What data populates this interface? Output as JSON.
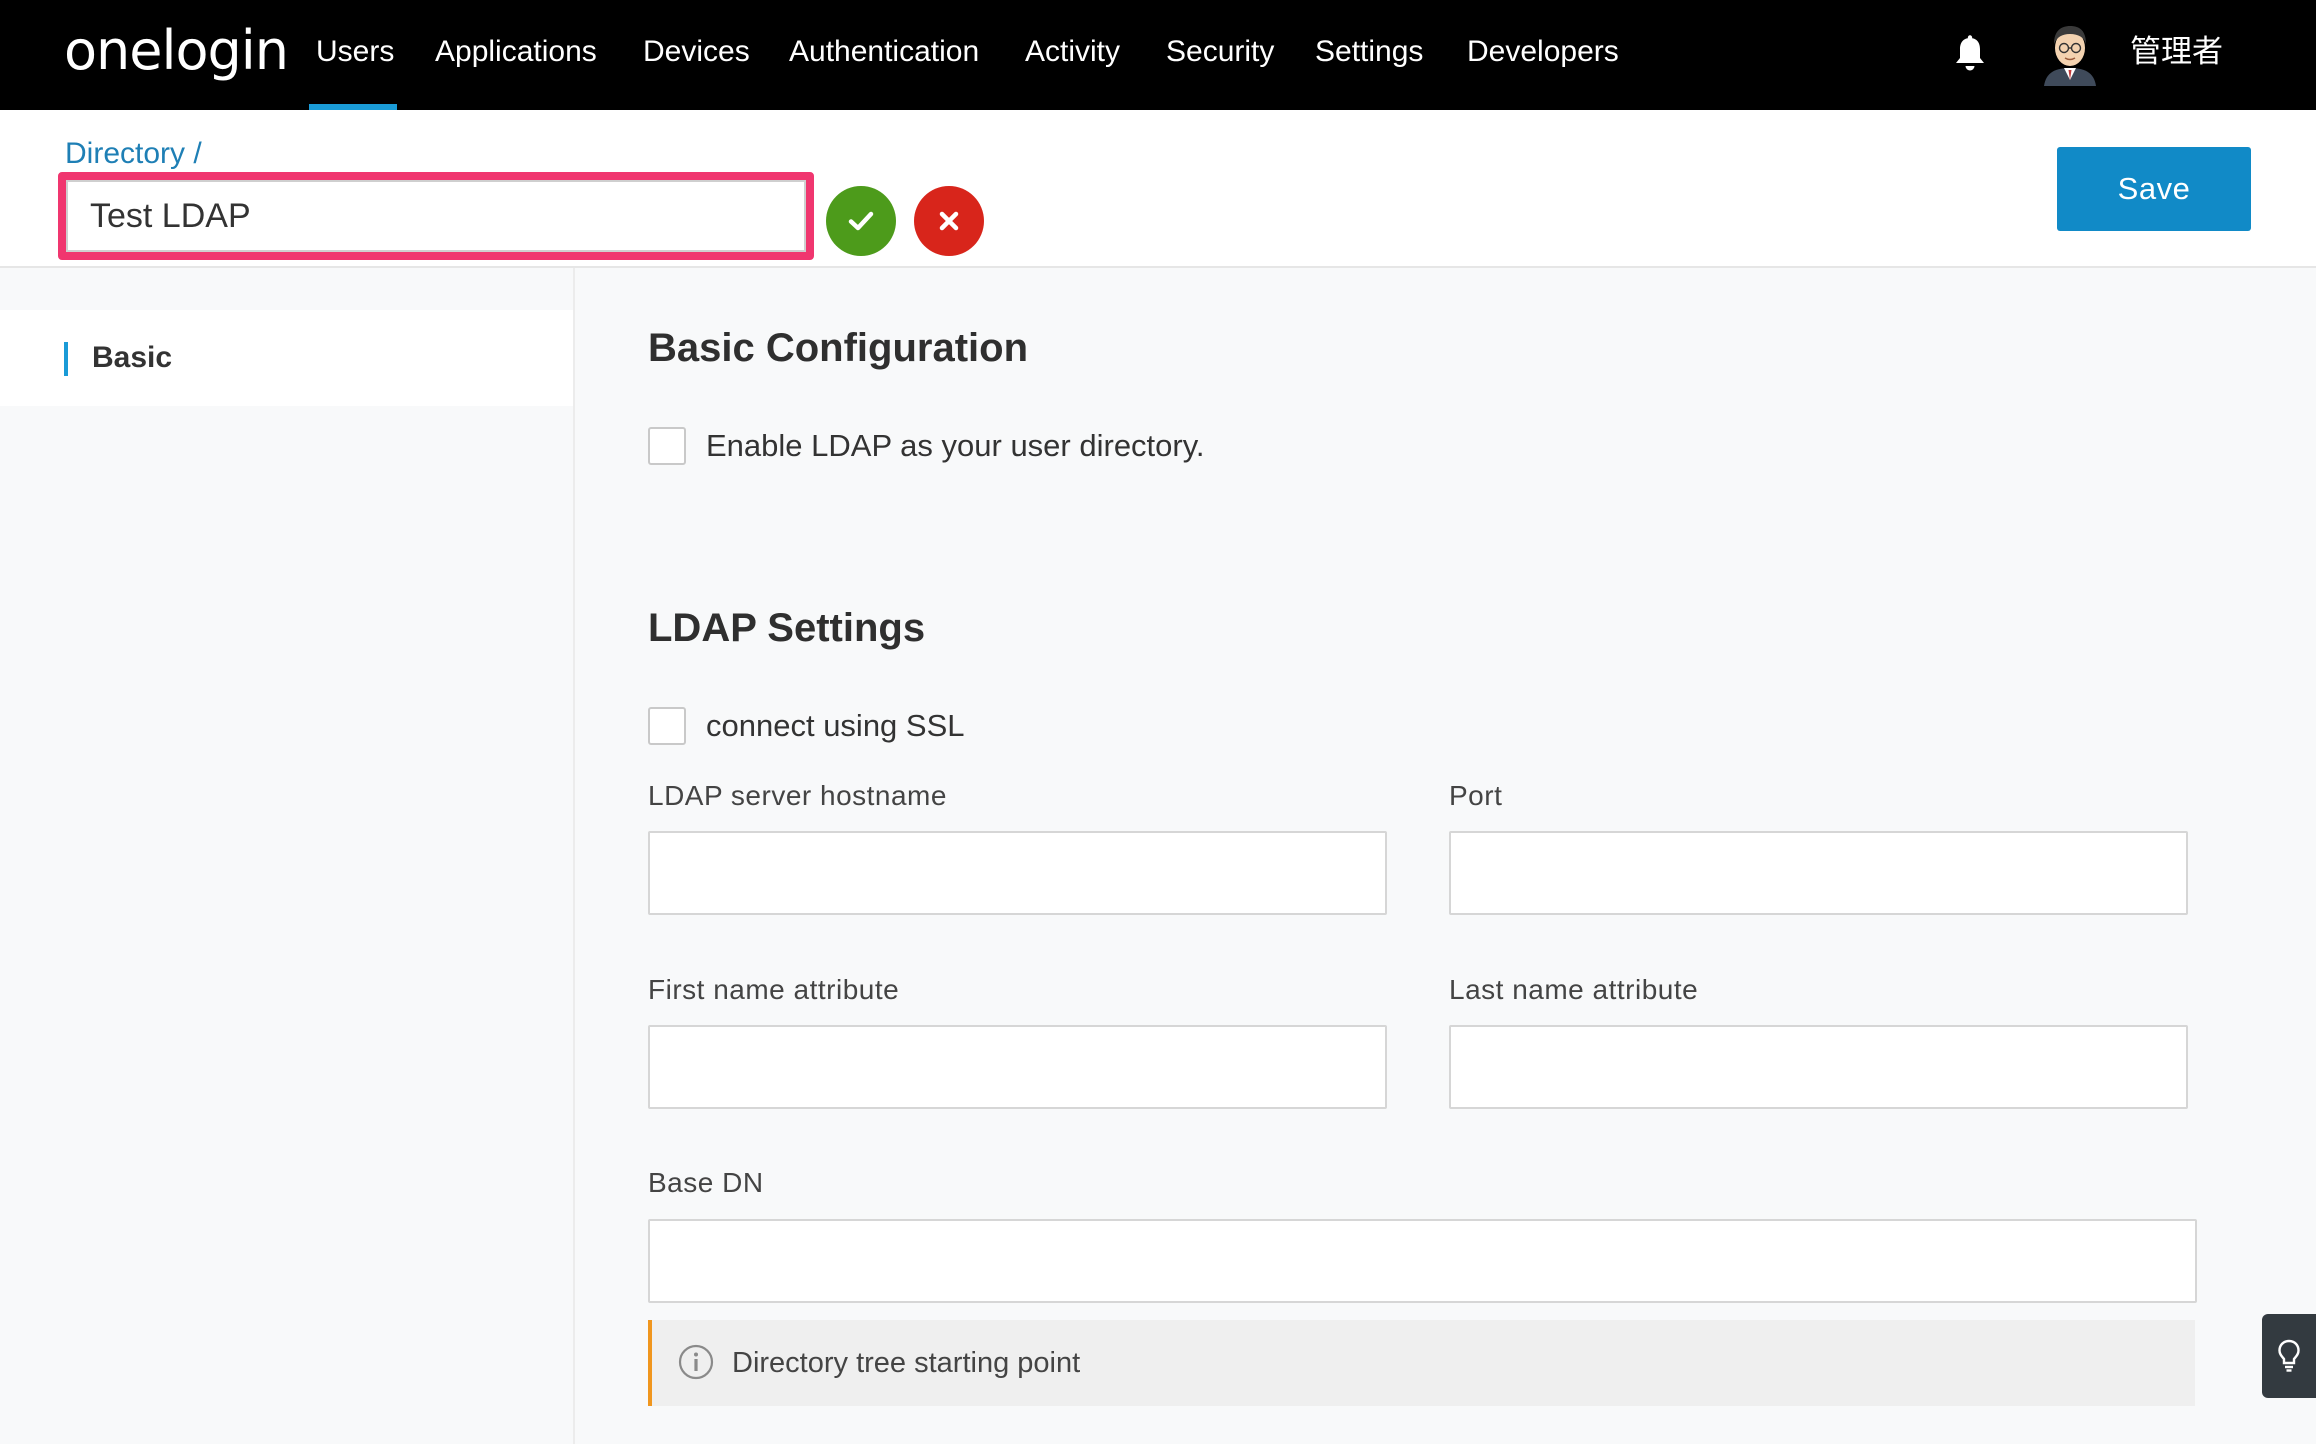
{
  "brand": {
    "logo_text": "onelogin"
  },
  "nav": {
    "items": [
      {
        "label": "Users",
        "active": true
      },
      {
        "label": "Applications",
        "active": false
      },
      {
        "label": "Devices",
        "active": false
      },
      {
        "label": "Authentication",
        "active": false
      },
      {
        "label": "Activity",
        "active": false
      },
      {
        "label": "Security",
        "active": false
      },
      {
        "label": "Settings",
        "active": false
      },
      {
        "label": "Developers",
        "active": false
      }
    ],
    "user_name": "管理者",
    "icons": [
      "bell-icon",
      "avatar"
    ]
  },
  "header": {
    "breadcrumb": "Directory /",
    "name_value": "Test LDAP",
    "confirm_icon": "checkmark-icon",
    "cancel_icon": "close-icon",
    "save_label": "Save"
  },
  "sidebar": {
    "items": [
      {
        "label": "Basic",
        "active": true
      }
    ]
  },
  "basic_configuration": {
    "title": "Basic Configuration",
    "enable_ldap_label": "Enable LDAP as your user directory.",
    "enable_ldap_checked": false
  },
  "ldap_settings": {
    "title": "LDAP Settings",
    "ssl_label": "connect using SSL",
    "ssl_checked": false,
    "hostname_label": "LDAP server hostname",
    "hostname_value": "",
    "port_label": "Port",
    "port_value": "",
    "first_name_label": "First name attribute",
    "first_name_value": "",
    "last_name_label": "Last name attribute",
    "last_name_value": "",
    "base_dn_label": "Base DN",
    "base_dn_value": "",
    "base_dn_hint": "Directory tree starting point"
  },
  "colors": {
    "nav_bg": "#000000",
    "accent": "#1a9bd7",
    "save_button": "#118ac7",
    "confirm": "#4d9b1b",
    "cancel": "#d8251b",
    "highlight_border": "#f0366f",
    "hint_accent": "#f0961e"
  },
  "help": {
    "icon": "lightbulb-icon"
  }
}
